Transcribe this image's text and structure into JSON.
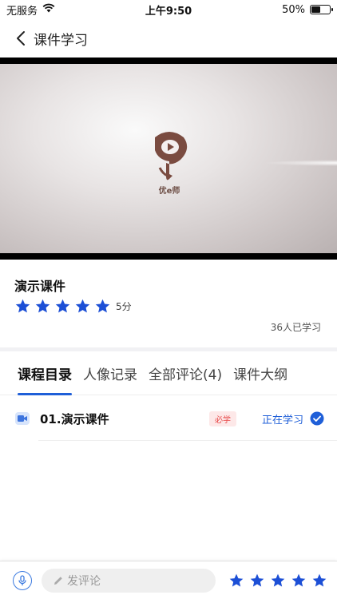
{
  "status_bar": {
    "carrier": "无服务",
    "time": "上午9:50",
    "battery": "50%",
    "battery_level": 0.5
  },
  "nav": {
    "title": "课件学习",
    "back_icon": "chevron-left-icon"
  },
  "video": {
    "logo_text": "优e师"
  },
  "course": {
    "title": "演示课件",
    "rating": 5,
    "rating_label": "5分",
    "learners": "36人已学习"
  },
  "tabs": [
    {
      "label": "课程目录",
      "active": true
    },
    {
      "label": "人像记录",
      "active": false
    },
    {
      "label": "全部评论(4)",
      "active": false
    },
    {
      "label": "课件大纲",
      "active": false
    }
  ],
  "lessons": [
    {
      "title": "01.演示课件",
      "badge": "必学",
      "status": "正在学习"
    }
  ],
  "comment_bar": {
    "placeholder": "发评论",
    "stars": 5
  },
  "colors": {
    "accent": "#1f5fd8",
    "star": "#1c4fd6",
    "badge_text": "#e84a4a",
    "badge_bg": "#fde8e8"
  }
}
